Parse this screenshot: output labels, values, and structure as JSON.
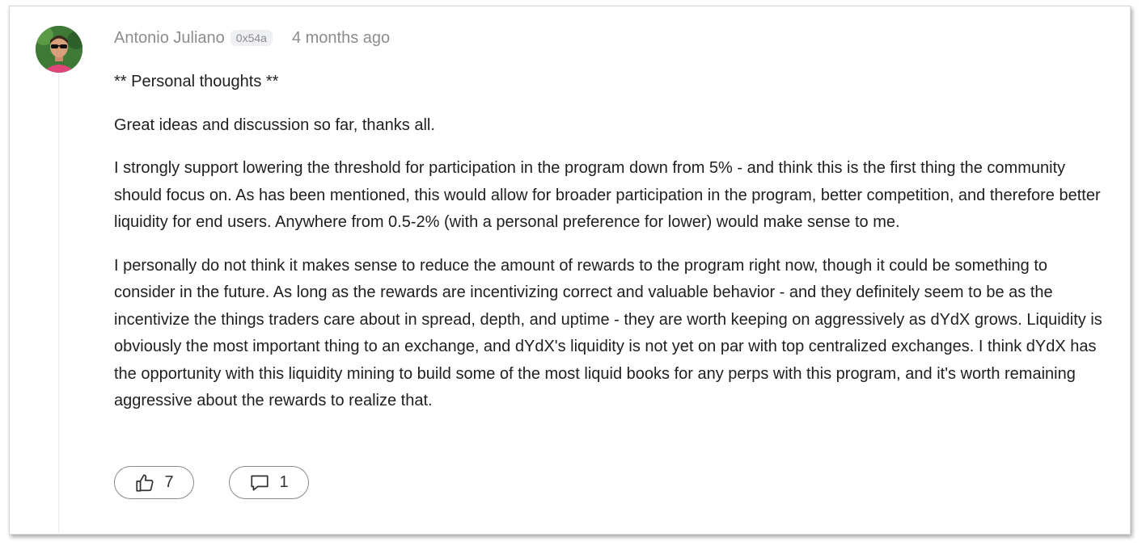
{
  "post": {
    "author": "Antonio Juliano",
    "address": "0x54a",
    "time": "4 months ago",
    "paragraphs": [
      "** Personal thoughts **",
      "Great ideas and discussion so far, thanks all.",
      "I strongly support lowering the threshold for participation in the program down from 5% - and think this is the first thing the community should focus on. As has been mentioned, this would allow for broader participation in the program, better competition, and therefore better liquidity for end users. Anywhere from 0.5-2% (with a personal preference for lower) would make sense to me.",
      "I personally do not think it makes sense to reduce the amount of rewards to the program right now, though it could be something to consider in the future. As long as the rewards are incentivizing correct and valuable behavior - and they definitely seem to be as the incentivize the things traders care about in spread, depth, and uptime - they are worth keeping on aggressively as dYdX grows. Liquidity is obviously the most important thing to an exchange, and dYdX's liquidity is not yet on par with top centralized exchanges. I think dYdX has the opportunity with this liquidity mining to build some of the most liquid books for any perps with this program, and it's worth remaining aggressive about the rewards to realize that."
    ],
    "likes": "7",
    "replies": "1",
    "like_icon": "thumbs-up-icon",
    "reply_icon": "speech-bubble-icon"
  }
}
